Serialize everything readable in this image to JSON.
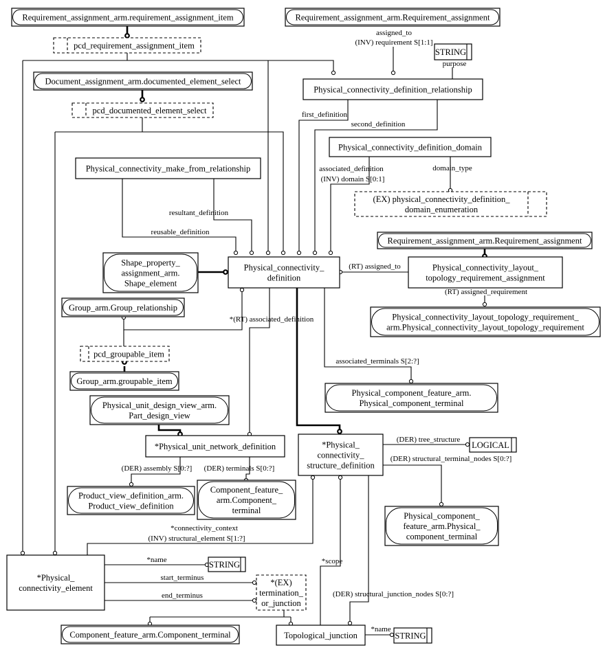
{
  "diagram": {
    "type": "EXPRESS-G schema diagram",
    "entities": [
      {
        "id": "req_item",
        "kind": "external",
        "lines": [
          "Requirement_assignment_arm.requirement_assignment_item"
        ]
      },
      {
        "id": "pcd_req_item",
        "kind": "select",
        "lines": [
          "pcd_requirement_assignment_item"
        ]
      },
      {
        "id": "doc_sel",
        "kind": "external",
        "lines": [
          "Document_assignment_arm.documented_element_select"
        ]
      },
      {
        "id": "pcd_doc_sel",
        "kind": "select",
        "lines": [
          "pcd_documented_element_select"
        ]
      },
      {
        "id": "req_assign_top",
        "kind": "external",
        "lines": [
          "Requirement_assignment_arm.Requirement_assignment"
        ]
      },
      {
        "id": "string1",
        "kind": "type",
        "lines": [
          "STRING"
        ]
      },
      {
        "id": "pcdr",
        "kind": "entity",
        "lines": [
          "Physical_connectivity_definition_relationship"
        ]
      },
      {
        "id": "pcdd",
        "kind": "entity",
        "lines": [
          "Physical_connectivity_definition_domain"
        ]
      },
      {
        "id": "pcmfr",
        "kind": "entity",
        "lines": [
          "Physical_connectivity_make_from_relationship"
        ]
      },
      {
        "id": "enum",
        "kind": "enum",
        "lines": [
          "(EX) physical_connectivity_definition_",
          "domain_enumeration"
        ]
      },
      {
        "id": "req_assign_mid",
        "kind": "external",
        "lines": [
          "Requirement_assignment_arm.Requirement_assignment"
        ]
      },
      {
        "id": "shape",
        "kind": "external",
        "lines": [
          "Shape_property_",
          "assignment_arm.",
          "Shape_element"
        ]
      },
      {
        "id": "pcd",
        "kind": "entity",
        "lines": [
          "Physical_connectivity_",
          "definition"
        ]
      },
      {
        "id": "pcltra",
        "kind": "entity",
        "lines": [
          "Physical_connectivity_layout_",
          "topology_requirement_assignment"
        ]
      },
      {
        "id": "group_rel",
        "kind": "external",
        "lines": [
          "Group_arm.Group_relationship"
        ]
      },
      {
        "id": "pcltr",
        "kind": "external",
        "lines": [
          "Physical_connectivity_layout_topology_requirement_",
          "arm.Physical_connectivity_layout_topology_requirement"
        ]
      },
      {
        "id": "pcd_groupable",
        "kind": "select",
        "lines": [
          "pcd_groupable_item"
        ]
      },
      {
        "id": "groupable",
        "kind": "external",
        "lines": [
          "Group_arm.groupable_item"
        ]
      },
      {
        "id": "pct1",
        "kind": "external",
        "lines": [
          "Physical_component_feature_arm.",
          "Physical_component_terminal"
        ]
      },
      {
        "id": "pdv",
        "kind": "external",
        "lines": [
          "Physical_unit_design_view_arm.",
          "Part_design_view"
        ]
      },
      {
        "id": "pund",
        "kind": "entity",
        "lines": [
          "*Physical_unit_network_definition"
        ]
      },
      {
        "id": "pcsd",
        "kind": "entity",
        "lines": [
          "*Physical_",
          "connectivity_",
          "structure_definition"
        ]
      },
      {
        "id": "logical",
        "kind": "type",
        "lines": [
          "LOGICAL"
        ]
      },
      {
        "id": "pvd",
        "kind": "external",
        "lines": [
          "Product_view_definition_arm.",
          "Product_view_definition"
        ]
      },
      {
        "id": "cft1",
        "kind": "external",
        "lines": [
          "Component_feature_",
          "arm.Component_",
          "terminal"
        ]
      },
      {
        "id": "pct2",
        "kind": "external",
        "lines": [
          "Physical_component_",
          "feature_arm.Physical_",
          "component_terminal"
        ]
      },
      {
        "id": "pce",
        "kind": "entity",
        "lines": [
          "*Physical_",
          "connectivity_element"
        ]
      },
      {
        "id": "string2",
        "kind": "type",
        "lines": [
          "STRING"
        ]
      },
      {
        "id": "toj",
        "kind": "select",
        "lines": [
          "*(EX)",
          "termination_",
          "or_junction"
        ]
      },
      {
        "id": "cft2",
        "kind": "external",
        "lines": [
          "Component_feature_arm.Component_terminal"
        ]
      },
      {
        "id": "tj",
        "kind": "entity",
        "lines": [
          "Topological_junction"
        ]
      },
      {
        "id": "string3",
        "kind": "type",
        "lines": [
          "STRING"
        ]
      }
    ],
    "labels": {
      "assigned_to": "assigned_to",
      "inv_requirement": "(INV) requirement S[1:1]",
      "purpose": "purpose",
      "first_definition": "first_definition",
      "second_definition": "second_definition",
      "associated_definition": "associated_definition",
      "inv_domain": "(INV) domain S[0:1]",
      "domain_type": "domain_type",
      "resultant_definition": "resultant_definition",
      "reusable_definition": "reusable_definition",
      "rt_assigned_to": "(RT) assigned_to",
      "rt_assigned_requirement": "(RT) assigned_requirement",
      "rt_associated_definition": "*(RT) associated_definition",
      "associated_terminals": "associated_terminals S[2:?]",
      "der_tree_structure": "(DER) tree_structure",
      "der_structural_terminal_nodes": "(DER) structural_terminal_nodes S[0:?]",
      "der_assembly": "(DER) assembly S[0:?]",
      "der_terminals": "(DER) terminals S[0:?]",
      "connectivity_context": "*connectivity_context",
      "inv_structural_element": "(INV) structural_element S[1:?]",
      "name1": "*name",
      "start_terminus": "start_terminus",
      "end_terminus": "end_terminus",
      "scope": "*scope",
      "der_structural_junction_nodes": "(DER) structural_junction_nodes S[0:?]",
      "name2": "*name"
    }
  }
}
